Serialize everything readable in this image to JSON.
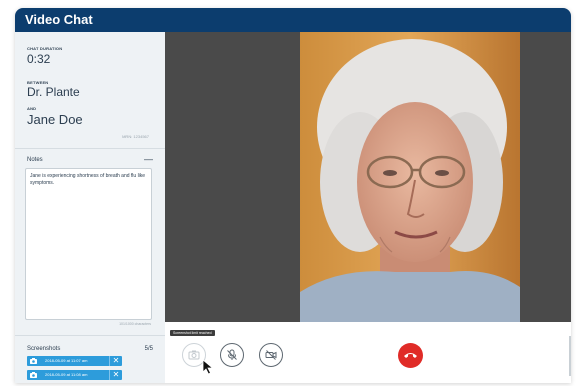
{
  "window": {
    "title": "Video Chat"
  },
  "chat": {
    "duration_label": "CHAT DURATION",
    "duration": "0:32",
    "between_label": "BETWEEN",
    "provider": "Dr. Plante",
    "and_label": "AND",
    "patient": "Jane Doe",
    "mrn": "MRN: 1234567"
  },
  "notes": {
    "heading": "Notes",
    "collapse": "—",
    "text": "Jane is experiencing shortness of breath and flu like symptoms.",
    "char_count": "101/1000 characters"
  },
  "screenshots": {
    "heading": "Screenshots",
    "count": "5/5",
    "items": [
      {
        "label": "2018-05-09 at 11:07 am",
        "remove": "✕"
      },
      {
        "label": "2018-05-09 at 11:08 am",
        "remove": "✕"
      }
    ]
  },
  "controls": {
    "tooltip": "Screenshot limit reached",
    "screenshot_icon": "camera-icon",
    "mute_icon": "mic-off-icon",
    "video_icon": "video-off-icon",
    "hangup_icon": "phone-hangup-icon",
    "hangup_color": "#e02b27"
  },
  "colors": {
    "titlebar": "#0c3d6e",
    "accent": "#2d9cdb"
  }
}
